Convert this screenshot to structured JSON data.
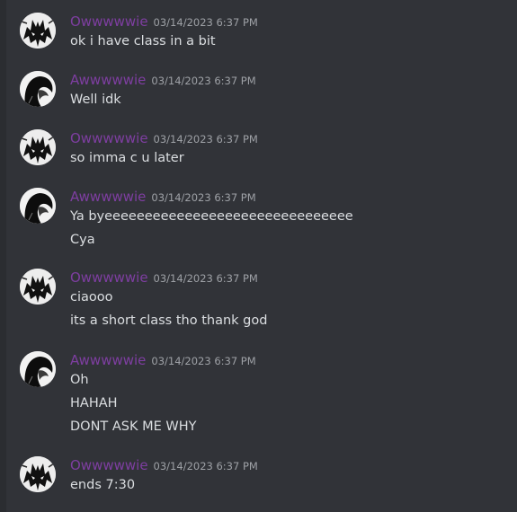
{
  "messages": [
    {
      "author": "Owwwwwie",
      "avatar": "wolf-avatar",
      "timestamp": "03/14/2023 6:37 PM",
      "lines": [
        "ok i have class in a bit"
      ]
    },
    {
      "author": "Awwwwwie",
      "avatar": "hair-avatar",
      "timestamp": "03/14/2023 6:37 PM",
      "lines": [
        "Well idk"
      ]
    },
    {
      "author": "Owwwwwie",
      "avatar": "wolf-avatar",
      "timestamp": "03/14/2023 6:37 PM",
      "lines": [
        "so imma c u later"
      ]
    },
    {
      "author": "Awwwwwie",
      "avatar": "hair-avatar",
      "timestamp": "03/14/2023 6:37 PM",
      "lines": [
        "Ya byeeeeeeeeeeeeeeeeeeeeeeeeeeeeeee",
        "Cya"
      ]
    },
    {
      "author": "Owwwwwie",
      "avatar": "wolf-avatar",
      "timestamp": "03/14/2023 6:37 PM",
      "lines": [
        "ciaooo",
        "its a short class tho thank god"
      ]
    },
    {
      "author": "Awwwwwie",
      "avatar": "hair-avatar",
      "timestamp": "03/14/2023 6:37 PM",
      "lines": [
        "Oh",
        "HAHAH",
        "DONT ASK ME WHY"
      ]
    },
    {
      "author": "Owwwwwie",
      "avatar": "wolf-avatar",
      "timestamp": "03/14/2023 6:37 PM",
      "lines": [
        "ends 7:30"
      ]
    }
  ],
  "colors": {
    "background": "#313338",
    "username": "#7e3ea1",
    "timestamp": "#9ea1a6",
    "text": "#dbdee1"
  }
}
